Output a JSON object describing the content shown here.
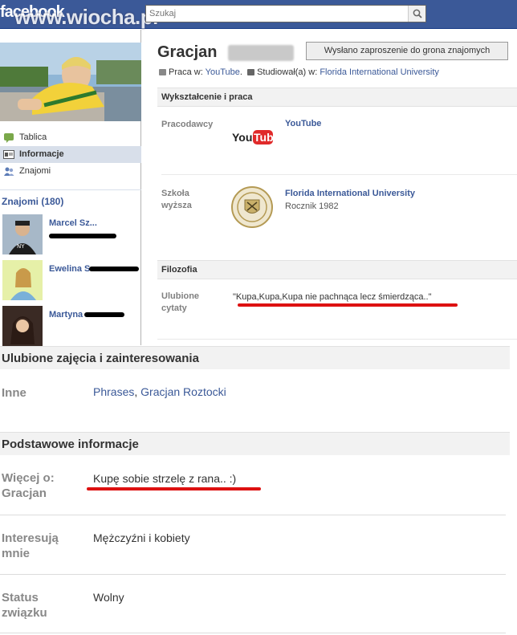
{
  "topbar": {
    "logo": "facebook",
    "watermark": "www.wiocha.pl",
    "search_placeholder": "Szukaj",
    "search_icon": "search-icon"
  },
  "left": {
    "nav": [
      {
        "label": "Tablica",
        "icon": "wall-icon"
      },
      {
        "label": "Informacje",
        "icon": "info-icon"
      },
      {
        "label": "Znajomi",
        "icon": "friends-icon"
      }
    ],
    "friends_title": "Znajomi (180)",
    "friends": [
      {
        "name": "Marcel Sz..."
      },
      {
        "name": "Ewelina S..."
      },
      {
        "name": "Martyna"
      }
    ]
  },
  "profile": {
    "name": "Gracjan",
    "add_friend_button": "Wysłano zaproszenie do grona znajomych",
    "work_prefix": "Praca w:",
    "work_place": "YouTube",
    "study_prefix": "Studiował(a) w:",
    "study_place": "Florida International University"
  },
  "education": {
    "section_title": "Wykształcenie i praca",
    "employers_label": "Pracodawcy",
    "employer_name": "YouTube",
    "employer_logo": "youtube-logo",
    "school_label": "Szkoła wyższa",
    "school_name": "Florida International University",
    "school_year": "Rocznik 1982"
  },
  "philosophy": {
    "section_title": "Filozofia",
    "quotes_label": "Ulubione cytaty",
    "quote": "\"Kupa,Kupa,Kupa nie pachnąca lecz śmierdząca..\""
  },
  "interests": {
    "section_title": "Ulubione zajęcia i zainteresowania",
    "other_label": "Inne",
    "other_link1": "Phrases",
    "other_link2": "Gracjan Roztocki"
  },
  "basic": {
    "section_title": "Podstawowe informacje",
    "more_about_label": "Więcej o: Gracjan",
    "more_about_value": "Kupę sobie strzelę z rana.. :)",
    "interested_label": "Interesują mnie",
    "interested_value": "Mężczyźni i kobiety",
    "status_label": "Status związku",
    "status_value": "Wolny"
  },
  "colors": {
    "brand": "#3b5998",
    "underline": "#dd1111"
  }
}
